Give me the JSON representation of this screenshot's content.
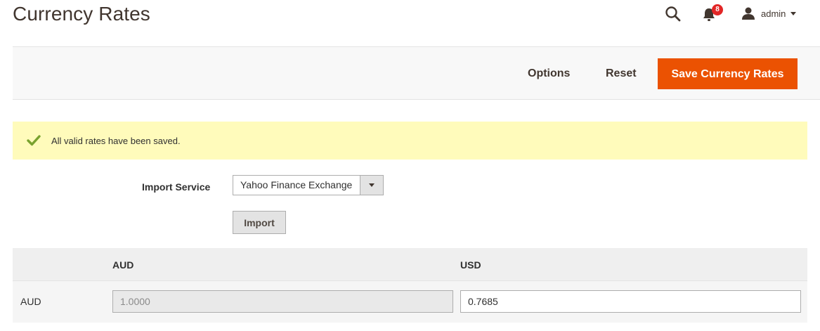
{
  "page": {
    "title": "Currency Rates"
  },
  "header": {
    "notifications_count": "8",
    "user_name": "admin"
  },
  "actions": {
    "options_label": "Options",
    "reset_label": "Reset",
    "save_label": "Save Currency Rates",
    "save_color": "#eb5202"
  },
  "message": {
    "text": "All valid rates have been saved.",
    "type": "success",
    "background": "#fffbbb",
    "icon_color": "#79a22e"
  },
  "import": {
    "label": "Import Service",
    "selected_service": "Yahoo Finance Exchange",
    "button_label": "Import"
  },
  "rates": {
    "columns": [
      "AUD",
      "USD"
    ],
    "rows": [
      {
        "currency": "AUD",
        "values": [
          "1.0000",
          "0.7685"
        ]
      }
    ]
  },
  "icons": {
    "search": "search-icon",
    "notifications": "bell-icon",
    "user": "user-icon",
    "message": "check-icon"
  }
}
